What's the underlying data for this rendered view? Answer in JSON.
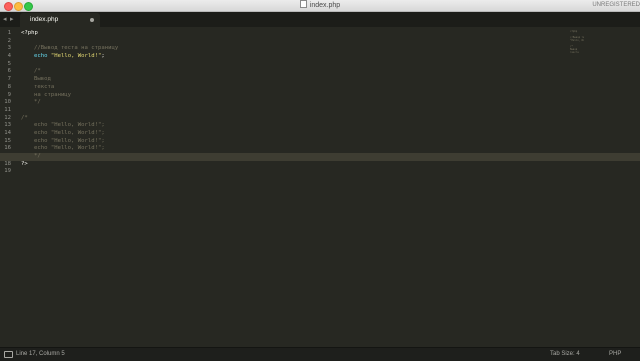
{
  "window": {
    "title": "index.php",
    "unregistered": "UNREGISTERED"
  },
  "tabbar": {
    "nav_left": "◂",
    "nav_right": "▸",
    "active_tab": {
      "label": "index.php",
      "modified_indicator": "dirty-dot-icon"
    }
  },
  "editor": {
    "line_numbers": [
      "1",
      "2",
      "3",
      "4",
      "5",
      "6",
      "7",
      "8",
      "9",
      "10",
      "11",
      "12",
      "13",
      "14",
      "15",
      "16",
      "17",
      "18",
      "19"
    ],
    "current_line": 17,
    "lines": {
      "l1": "<?php",
      "l3": "//Вывод теста на страницу",
      "l4_kw": "echo",
      "l4_str": "\"Hello, World!\"",
      "l4_end": ";",
      "l6": "/*",
      "l7": "Вывод",
      "l8": "текста",
      "l9": "на страницу",
      "l10": "*/",
      "l12": "/*",
      "l13": "echo \"Hello, World!\";",
      "l14": "echo \"Hello, World!\";",
      "l15": "echo \"Hello, World!\";",
      "l16": "echo \"Hello, World!\";",
      "l17": "*/",
      "l18": "?>"
    }
  },
  "statusbar": {
    "position": "Line 17, Column 5",
    "tab_size": "Tab Size: 4",
    "syntax": "PHP"
  },
  "colors": {
    "background": "#272822",
    "comment": "#75715e",
    "keyword": "#66d9ef",
    "string": "#e6db74",
    "foreground": "#f8f8f2"
  }
}
